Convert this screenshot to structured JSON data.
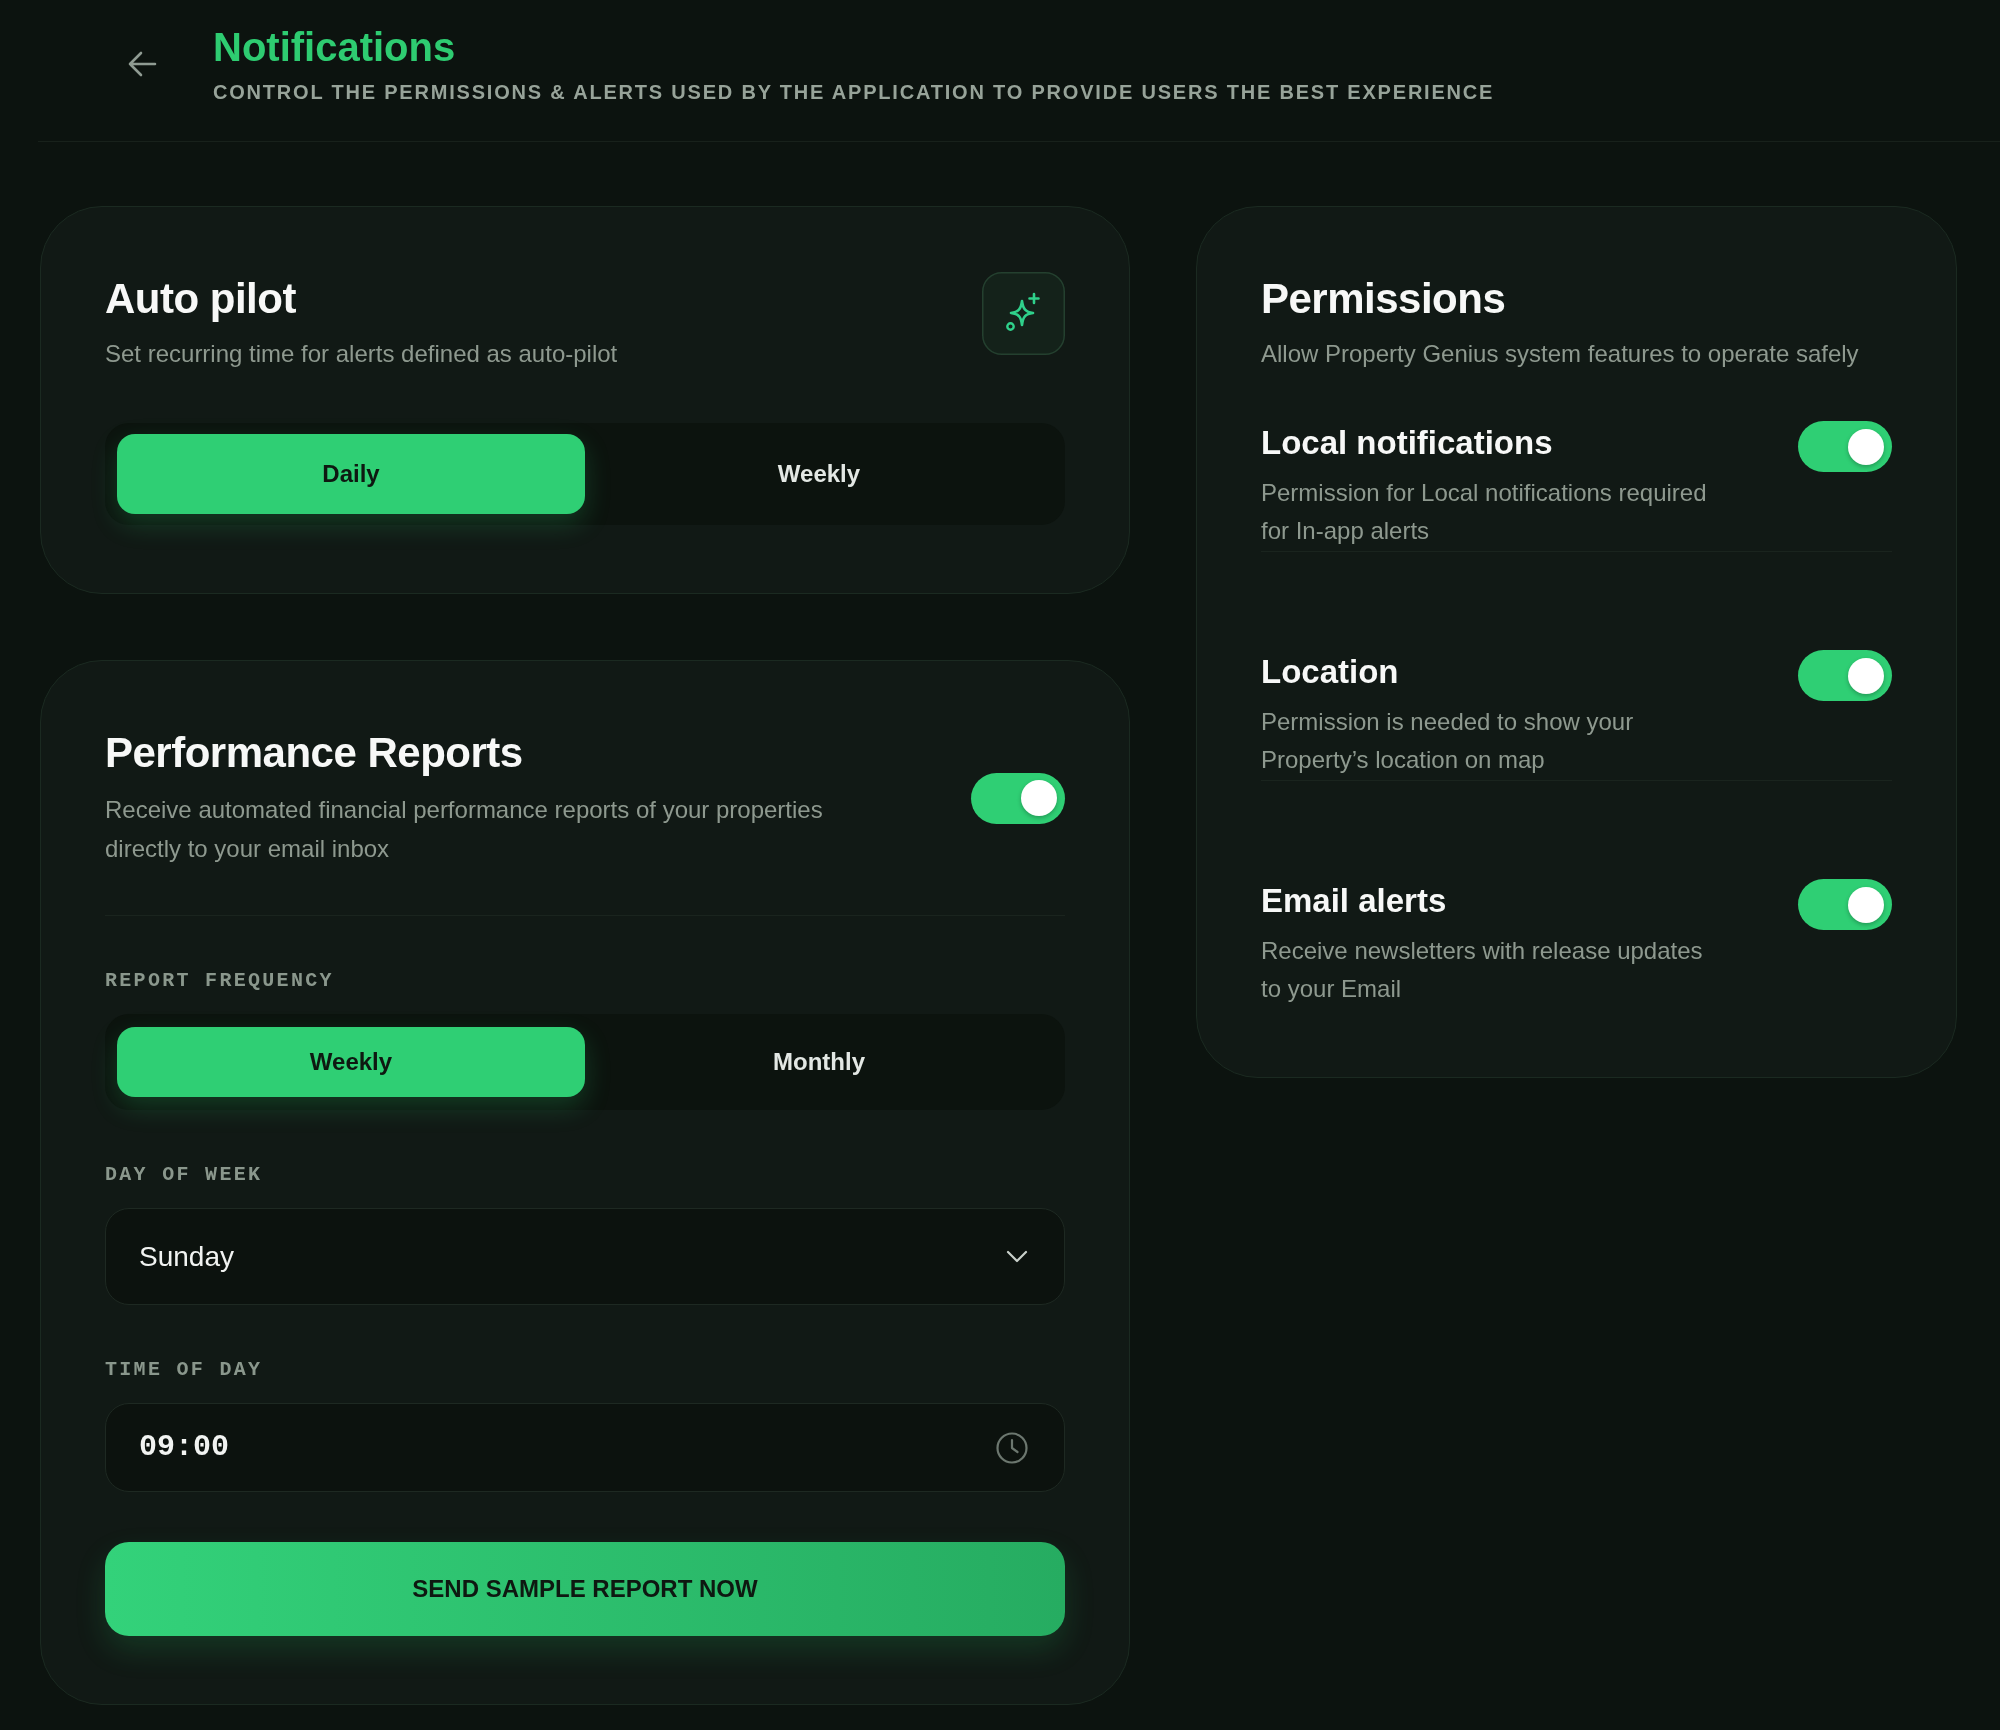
{
  "header": {
    "title": "Notifications",
    "subtitle": "CONTROL THE PERMISSIONS & ALERTS USED BY THE APPLICATION TO PROVIDE USERS THE BEST EXPERIENCE"
  },
  "autopilot": {
    "title": "Auto pilot",
    "description": "Set recurring time for alerts defined as auto-pilot",
    "options": [
      {
        "label": "Daily",
        "selected": true
      },
      {
        "label": "Weekly",
        "selected": false
      }
    ]
  },
  "performance_reports": {
    "title": "Performance Reports",
    "description": "Receive automated financial performance reports of your properties directly to your email inbox",
    "on": true,
    "fields": [
      {
        "kind": "segmented",
        "label": "REPORT FREQUENCY",
        "options": [
          {
            "label": "Weekly",
            "selected": true
          },
          {
            "label": "Monthly",
            "selected": false
          }
        ]
      },
      {
        "kind": "select",
        "label": "DAY OF WEEK",
        "value": "Sunday"
      },
      {
        "kind": "time",
        "label": "TIME OF DAY",
        "value": "09:00"
      }
    ],
    "button": "SEND SAMPLE REPORT NOW"
  },
  "permissions": {
    "title": "Permissions",
    "description": "Allow Property Genius system features to operate safely",
    "items": [
      {
        "title": "Local notifications",
        "description": "Permission for Local notifications required for In-app alerts",
        "on": true
      },
      {
        "title": "Location",
        "description": "Permission is needed to show your Property’s location on map",
        "on": true
      },
      {
        "title": "Email alerts",
        "description": "Receive newsletters with release updates to your Email",
        "on": true
      }
    ]
  }
}
